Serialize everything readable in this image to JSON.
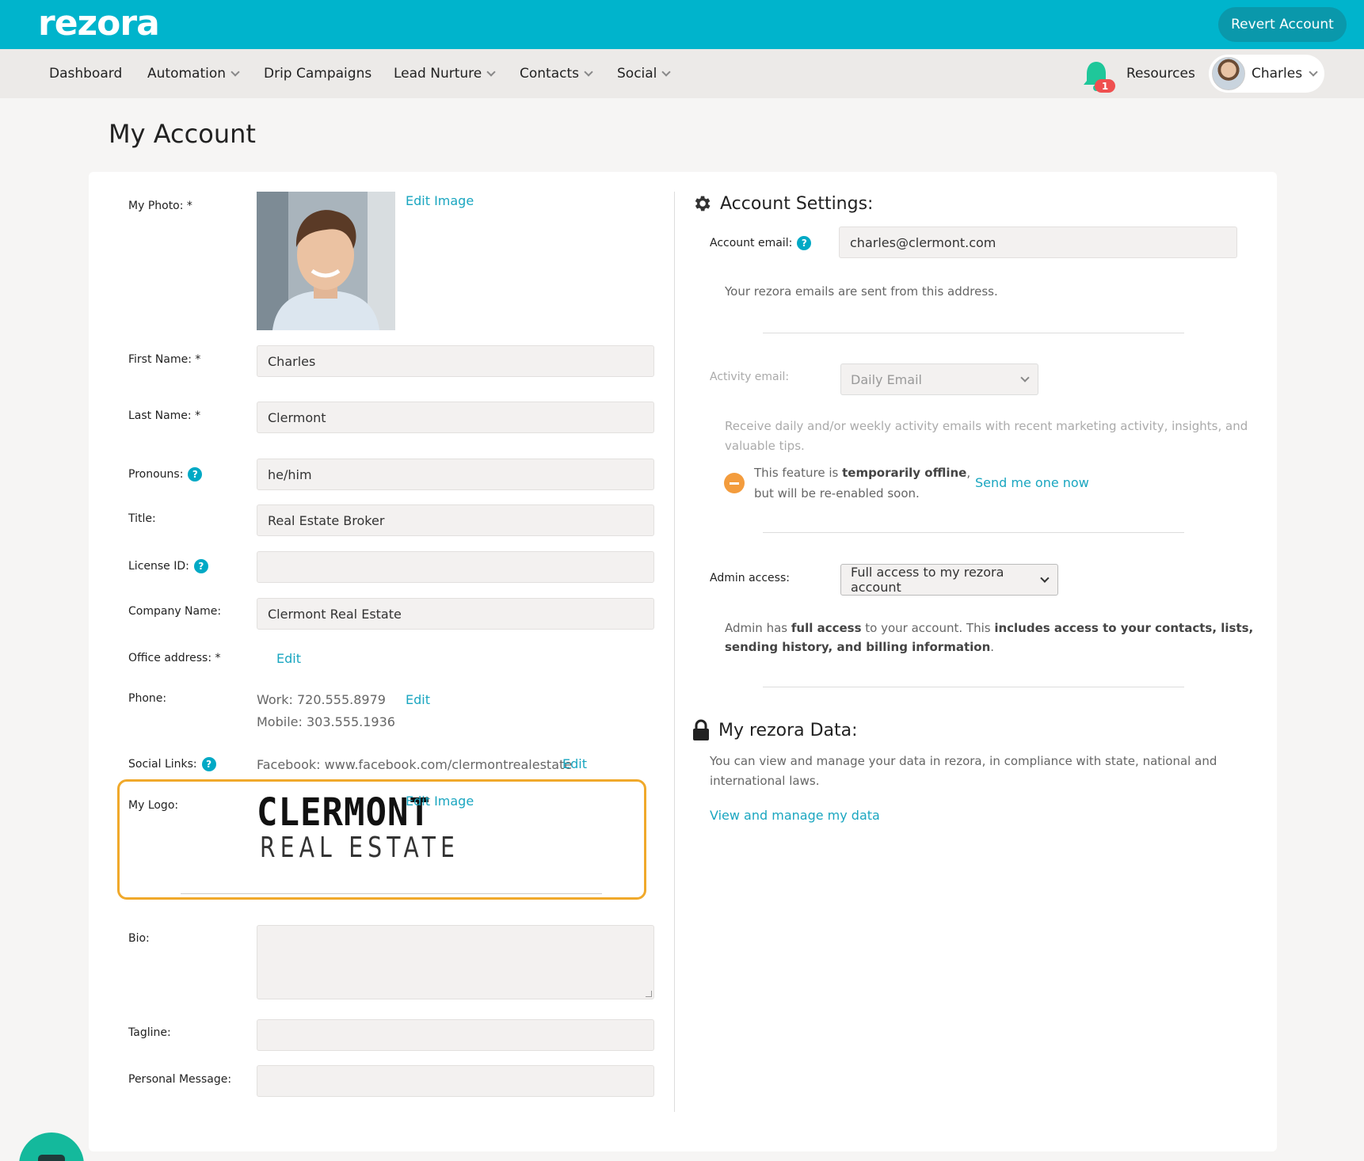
{
  "header": {
    "logo": "rezora",
    "revert_label": "Revert Account"
  },
  "nav": {
    "items": [
      {
        "label": "Dashboard"
      },
      {
        "label": "Automation"
      },
      {
        "label": "Drip Campaigns"
      },
      {
        "label": "Lead Nurture"
      },
      {
        "label": "Contacts"
      },
      {
        "label": "Social"
      }
    ],
    "notification_count": "1",
    "resources": "Resources",
    "user_name": "Charles"
  },
  "page": {
    "title": "My Account"
  },
  "profile": {
    "photo_label": "My Photo: *",
    "edit_image": "Edit Image",
    "first_name_label": "First Name: *",
    "first_name": "Charles",
    "last_name_label": "Last Name: *",
    "last_name": "Clermont",
    "pronouns_label": "Pronouns:",
    "pronouns": "he/him",
    "title_label": "Title:",
    "title": "Real Estate Broker",
    "license_label": "License ID:",
    "license": "",
    "company_label": "Company Name:",
    "company": "Clermont Real Estate",
    "office_label": "Office address: *",
    "edit": "Edit",
    "phone_label": "Phone:",
    "phone_work": "Work: 720.555.8979",
    "phone_mobile": "Mobile: 303.555.1936",
    "social_label": "Social Links:",
    "social_facebook": "Facebook: www.facebook.com/clermontrealestate",
    "logo_label": "My Logo:",
    "logo_line1": "CLERMONT",
    "logo_line2": "REAL ESTATE",
    "bio_label": "Bio:",
    "tagline_label": "Tagline:",
    "personal_message_label": "Personal Message:"
  },
  "settings": {
    "title": "Account Settings:",
    "account_email_label": "Account email:",
    "account_email": "charles@clermont.com",
    "account_email_note": "Your rezora emails are sent from this address.",
    "activity_email_label": "Activity email:",
    "activity_email_value": "Daily Email",
    "activity_note_1": "Receive daily and/or weekly activity emails with recent marketing activity, insights, and",
    "activity_note_2": "valuable tips.",
    "offline_1a": "This feature is ",
    "offline_1b": "temporarily offline",
    "offline_1c": ",",
    "offline_2": "but will be re-enabled soon.",
    "send_now": "Send me one now",
    "admin_label": "Admin access:",
    "admin_value": "Full access to my rezora account",
    "admin_note_a": "Admin has ",
    "admin_note_b": "full access",
    "admin_note_c": " to your account. This ",
    "admin_note_d": "includes access to your contacts, lists,",
    "admin_note_e": "sending history, and billing information",
    "admin_note_f": "."
  },
  "data_section": {
    "title": "My rezora Data:",
    "note_1": "You can view and manage your data in rezora, in compliance with state, national and",
    "note_2": "international laws.",
    "link": "View and manage my data"
  },
  "colors": {
    "brand": "#00b4cc",
    "link": "#1aa6c0",
    "highlight": "#f0a92b",
    "warning": "#f39c3d",
    "badge": "#ef4f4f"
  }
}
